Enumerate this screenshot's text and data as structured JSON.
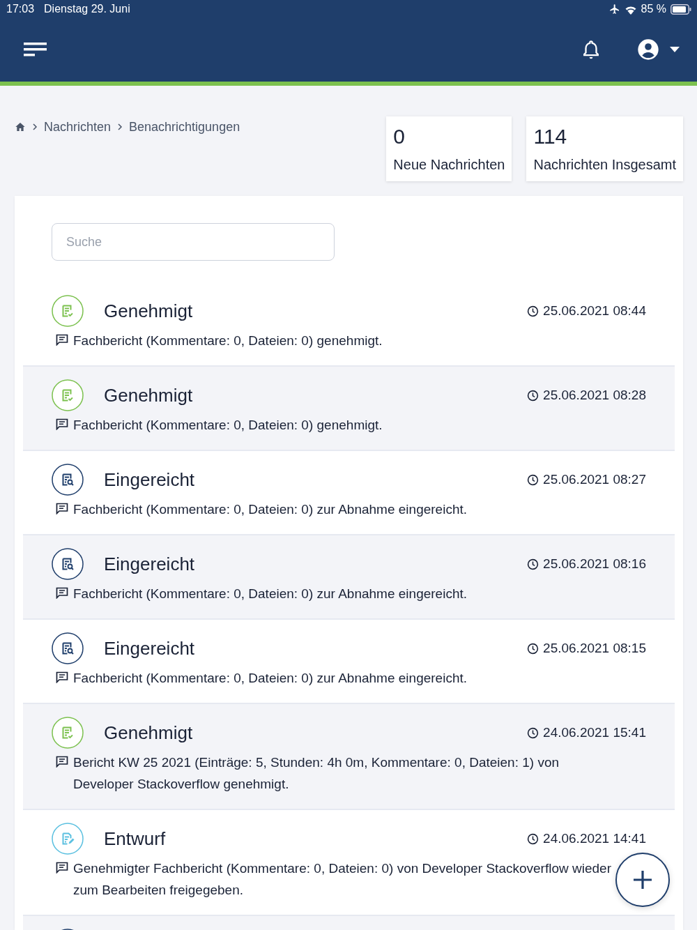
{
  "status_bar": {
    "time": "17:03",
    "date": "Dienstag 29. Juni",
    "battery_text": "85 %"
  },
  "breadcrumb": [
    "Nachrichten",
    "Benachrichtigungen"
  ],
  "stats": [
    {
      "value": "0",
      "label": "Neue Nachrichten"
    },
    {
      "value": "114",
      "label": "Nachrichten Insgesamt"
    }
  ],
  "search": {
    "placeholder": "Suche"
  },
  "notifications": [
    {
      "kind": "approved",
      "title": "Genehmigt",
      "time": "25.06.2021 08:44",
      "text": "Fachbericht (Kommentare: 0, Dateien: 0) genehmigt."
    },
    {
      "kind": "approved",
      "title": "Genehmigt",
      "time": "25.06.2021 08:28",
      "text": "Fachbericht (Kommentare: 0, Dateien: 0) genehmigt."
    },
    {
      "kind": "submitted",
      "title": "Eingereicht",
      "time": "25.06.2021 08:27",
      "text": "Fachbericht (Kommentare: 0, Dateien: 0) zur Abnahme eingereicht."
    },
    {
      "kind": "submitted",
      "title": "Eingereicht",
      "time": "25.06.2021 08:16",
      "text": "Fachbericht (Kommentare: 0, Dateien: 0) zur Abnahme eingereicht."
    },
    {
      "kind": "submitted",
      "title": "Eingereicht",
      "time": "25.06.2021 08:15",
      "text": "Fachbericht (Kommentare: 0, Dateien: 0) zur Abnahme eingereicht."
    },
    {
      "kind": "approved",
      "title": "Genehmigt",
      "time": "24.06.2021 15:41",
      "text": "Bericht KW 25 2021 (Einträge: 5, Stunden: 4h 0m, Kommentare: 0, Dateien: 1) von Developer Stackoverflow genehmigt."
    },
    {
      "kind": "draft",
      "title": "Entwurf",
      "time": "24.06.2021 14:41",
      "text": "Genehmigter Fachbericht (Kommentare: 0, Dateien: 0) von Developer Stackoverflow wieder zum Bearbeiten freigegeben."
    },
    {
      "kind": "submitted"
    }
  ]
}
